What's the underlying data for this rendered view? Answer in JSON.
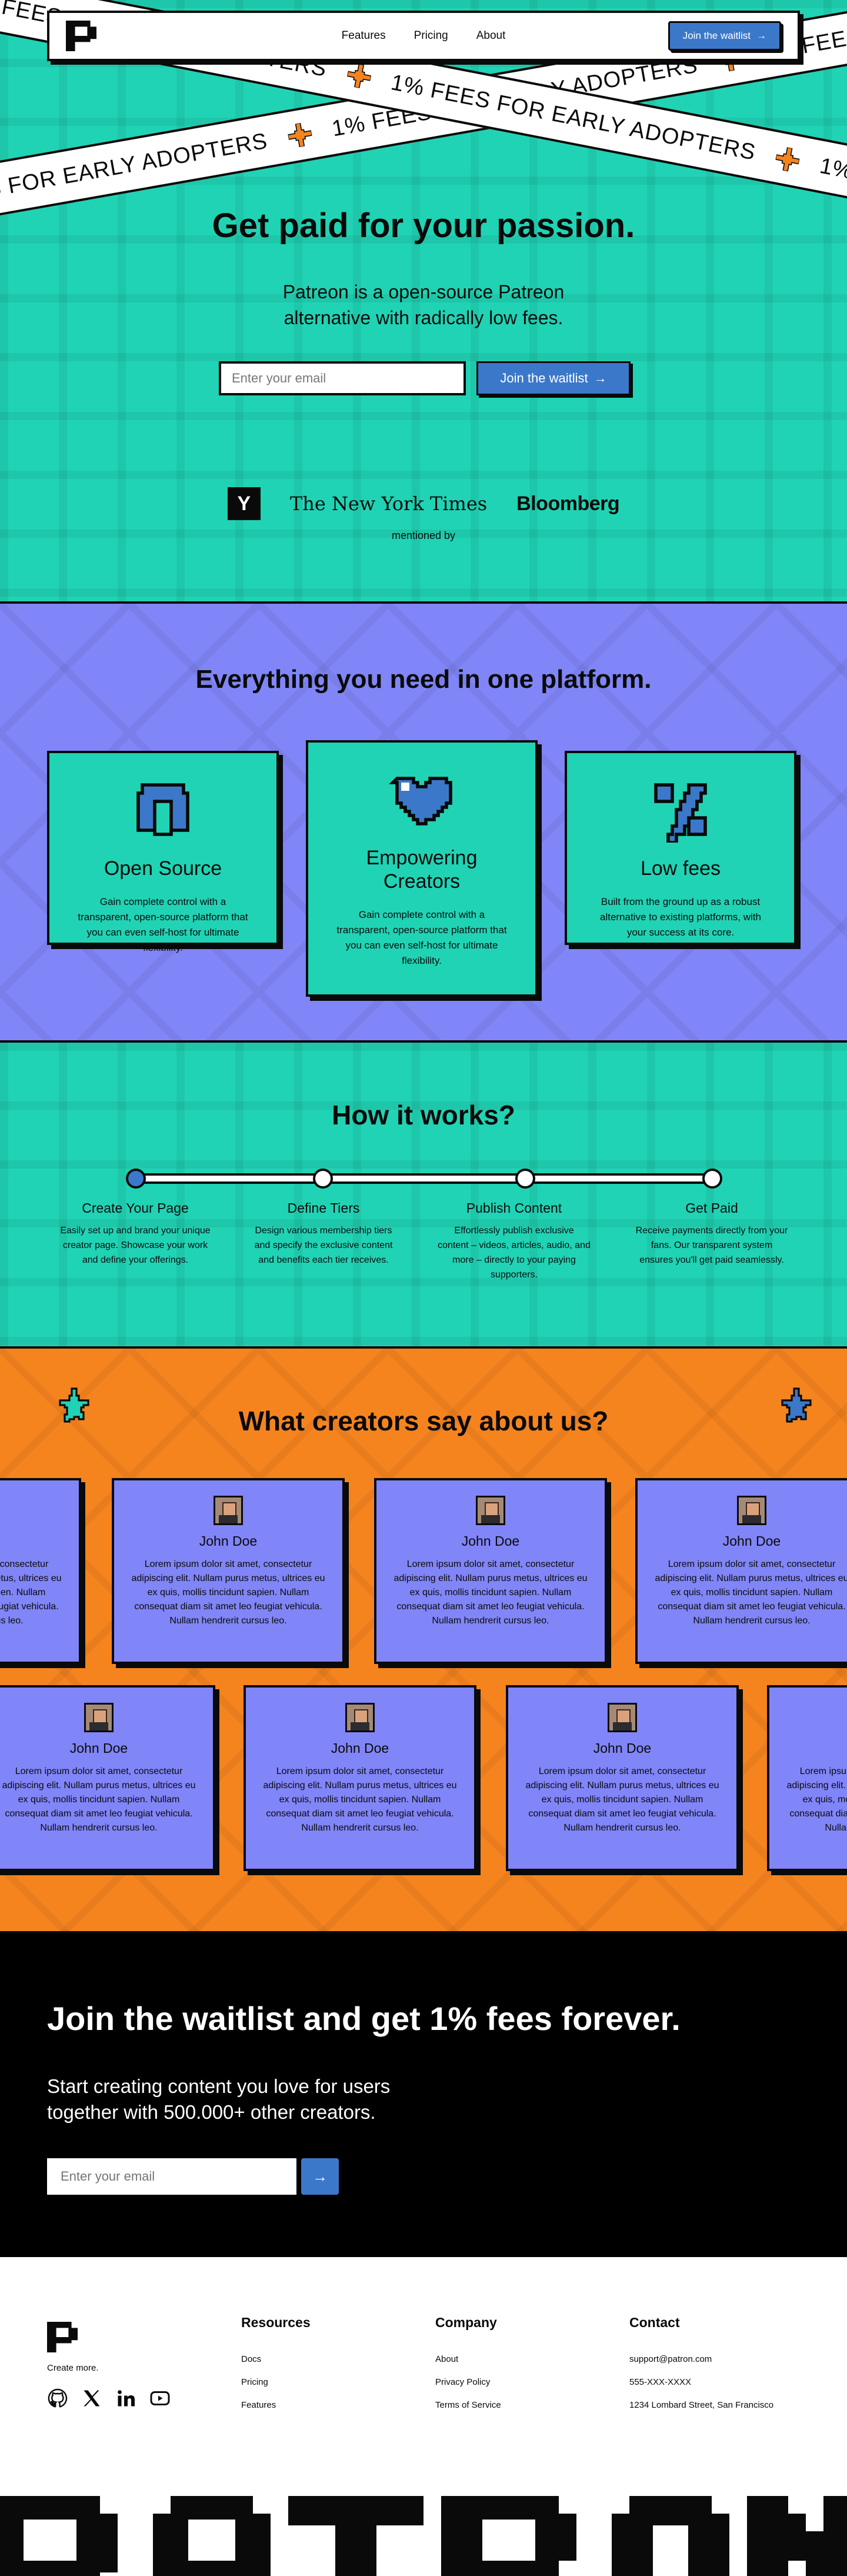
{
  "nav": {
    "links": [
      "Features",
      "Pricing",
      "About"
    ],
    "cta_label": "Join the waitlist"
  },
  "hero": {
    "tape_text": "1% FEES FOR EARLY ADOPTERS",
    "title": "Get paid for your passion.",
    "subtitle_line1": "Patreon is a open-source Patreon",
    "subtitle_line2": "alternative with radically low fees.",
    "email_placeholder": "Enter your email",
    "cta_label": "Join the waitlist",
    "press": {
      "yc": "Y",
      "nyt": "The New York Times",
      "bloomberg": "Bloomberg"
    },
    "mentioned_label": "mentioned by"
  },
  "features": {
    "title": "Everything you need in one platform.",
    "cards": [
      {
        "icon": "magnet-icon",
        "title": "Open Source",
        "text": "Gain complete control with a transparent, open-source platform that you can even self-host for ultimate flexibility."
      },
      {
        "icon": "heart-icon",
        "title": "Empowering Creators",
        "text": "Gain complete control with a transparent, open-source platform that you can even self-host for ultimate flexibility."
      },
      {
        "icon": "percent-icon",
        "title": "Low fees",
        "text": "Built from the ground up as a robust alternative to existing platforms, with your success at its core."
      }
    ]
  },
  "how": {
    "title": "How it works?",
    "steps": [
      {
        "title": "Create Your Page",
        "text": "Easily set up and brand your unique creator page. Showcase your work and define your offerings."
      },
      {
        "title": "Define Tiers",
        "text": "Design various membership tiers and specify the exclusive content and benefits each tier receives."
      },
      {
        "title": "Publish Content",
        "text": "Effortlessly publish exclusive content – videos, articles, audio, and more – directly to your paying supporters."
      },
      {
        "title": "Get Paid",
        "text": "Receive payments directly from your fans. Our transparent system ensures you'll get paid seamlessly."
      }
    ]
  },
  "testimonials": {
    "title": "What creators say about us?",
    "name": "John Doe",
    "quote": "Lorem ipsum dolor sit amet, consectetur adipiscing elit. Nullam purus metus, ultrices eu ex quis, mollis tincidunt sapien. Nullam consequat diam sit amet leo feugiat vehicula. Nullam hendrerit cursus leo."
  },
  "waitlist": {
    "title": "Join the waitlist and get 1% fees forever.",
    "sub_line1": "Start creating content you love for users",
    "sub_line2": "together with 500.000+ other creators.",
    "email_placeholder": "Enter your email"
  },
  "footer": {
    "tagline": "Create more.",
    "resources": {
      "title": "Resources",
      "links": [
        "Docs",
        "Pricing",
        "Features"
      ]
    },
    "company": {
      "title": "Company",
      "links": [
        "About",
        "Privacy Policy",
        "Terms of Service"
      ]
    },
    "contact": {
      "title": "Contact",
      "lines": [
        "support@patron.com",
        "555-XXX-XXXX",
        "1234 Lombard Street, San Francisco"
      ]
    },
    "giant_word": "PATRON"
  },
  "colors": {
    "teal": "#20d3b4",
    "periwinkle": "#8085f7",
    "orange": "#f5841f",
    "blue": "#3b78c9",
    "black": "#0a0a0a"
  }
}
